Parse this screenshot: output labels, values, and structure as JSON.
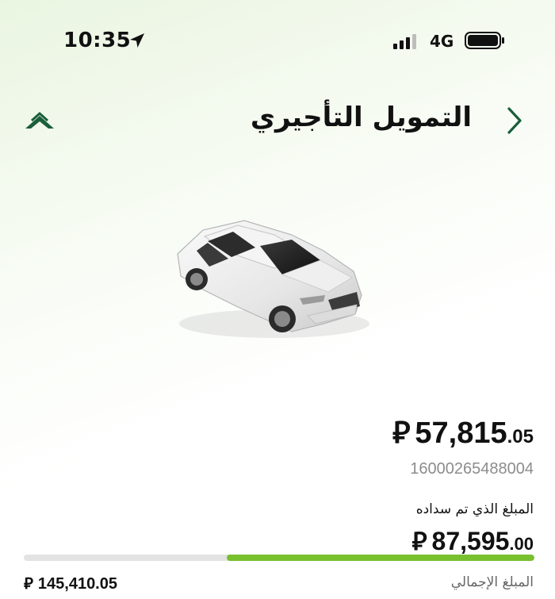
{
  "status_bar": {
    "time": "10:35",
    "network": "4G",
    "icons": [
      "location-arrow-icon",
      "signal-bars-icon",
      "battery-icon"
    ]
  },
  "header": {
    "title": "التمويل التأجيري",
    "back_icon": "chevron-right-icon",
    "logo_icon": "bank-logo-icon"
  },
  "car": {
    "image": "sedan-car-image",
    "color": "white"
  },
  "finance": {
    "remaining_amount_major": "57,815",
    "remaining_amount_minor": ".05",
    "currency_symbol": "⃁",
    "account_number": "16000265488004",
    "paid_label": "المبلغ الذي تم سداده",
    "paid_amount_major": "87,595",
    "paid_amount_minor": ".00",
    "total_label": "المبلغ الإجمالي",
    "total_amount": "145,410.05",
    "paid_fraction": 0.6024
  },
  "colors": {
    "accent": "#78c02e",
    "brand_dark_green": "#1b5e3a",
    "muted_text": "#8c8c8c"
  }
}
